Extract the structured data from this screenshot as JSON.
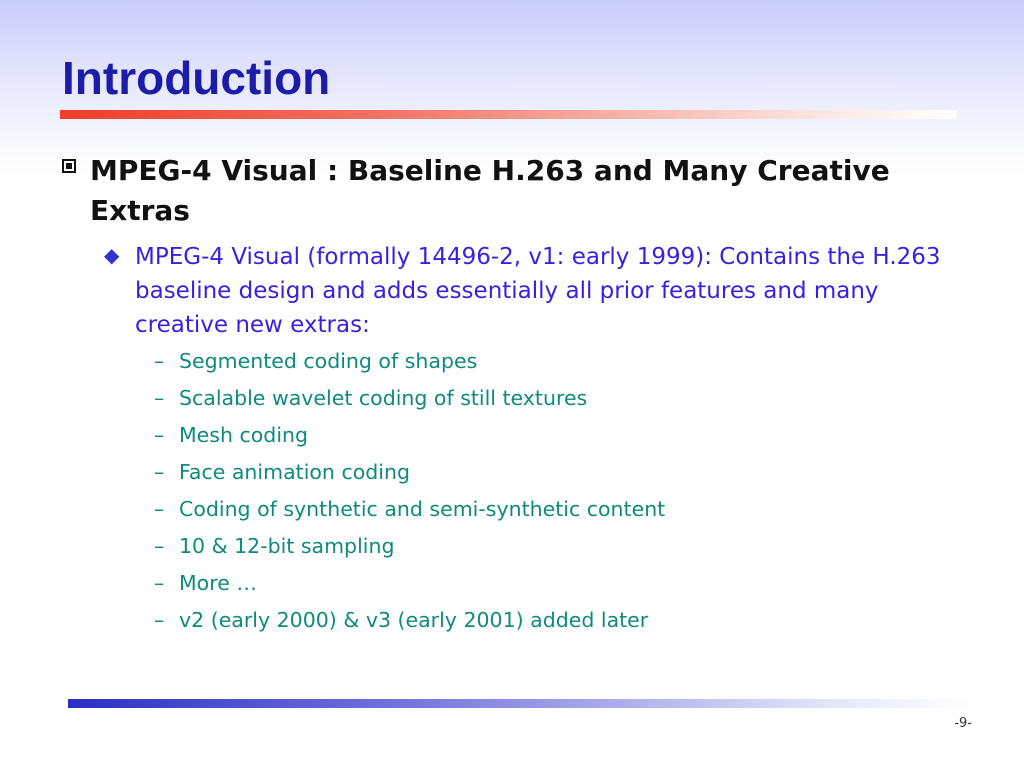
{
  "slide": {
    "title": "Introduction",
    "page_number": "-9-",
    "colors": {
      "title": "#1c1ca8",
      "level1_text": "#111111",
      "level2_text": "#3b1ee0",
      "level3_text": "#0f8a7d",
      "title_rule": "#f03c2a",
      "bottom_rule": "#2b2fc4"
    }
  },
  "content": {
    "level1": {
      "bullet_icon": "square-bullet-icon",
      "text": "MPEG-4 Visual : Baseline H.263 and Many Creative Extras"
    },
    "level2": {
      "bullet_icon": "diamond-bullet-icon",
      "text": "MPEG-4 Visual (formally 14496-2, v1: early 1999): Contains the H.263 baseline design and adds essentially all prior features and many creative new extras:"
    },
    "level3": [
      {
        "dash": "–",
        "text": "Segmented coding of shapes"
      },
      {
        "dash": "–",
        "text": "Scalable wavelet coding of still textures"
      },
      {
        "dash": "–",
        "text": "Mesh coding"
      },
      {
        "dash": "–",
        "text": "Face animation coding"
      },
      {
        "dash": "–",
        "text": "Coding of synthetic and semi-synthetic content"
      },
      {
        "dash": "–",
        "text": "10 & 12-bit sampling"
      },
      {
        "dash": "–",
        "text": "More …"
      },
      {
        "dash": "–",
        "text": "v2 (early 2000) & v3 (early 2001) added later"
      }
    ]
  }
}
